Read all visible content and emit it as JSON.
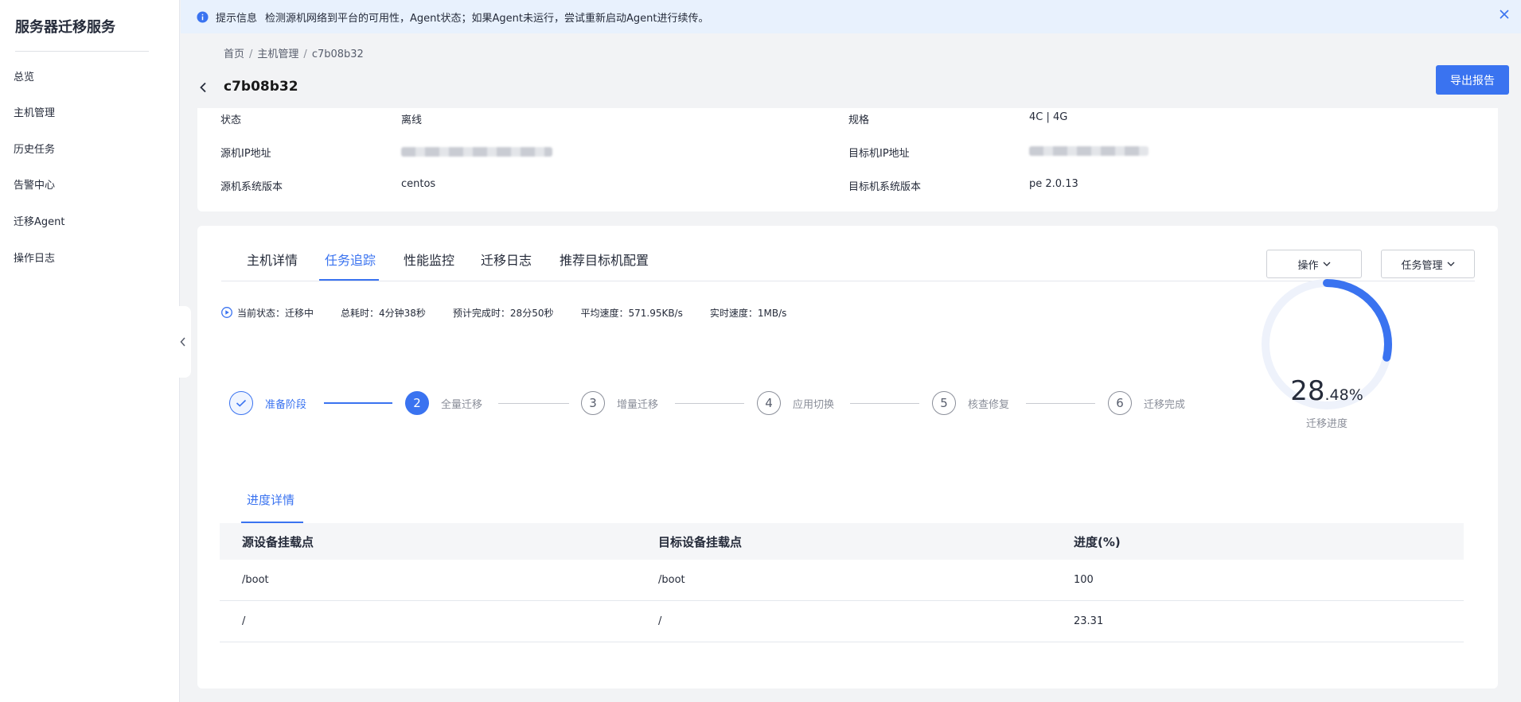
{
  "sidebar": {
    "title": "服务器迁移服务",
    "items": [
      {
        "label": "总览"
      },
      {
        "label": "主机管理"
      },
      {
        "label": "历史任务"
      },
      {
        "label": "告警中心"
      },
      {
        "label": "迁移Agent"
      },
      {
        "label": "操作日志"
      }
    ]
  },
  "notice": {
    "title": "提示信息",
    "text": "检测源机网络到平台的可用性，Agent状态；如果Agent未运行，尝试重新启动Agent进行续传。"
  },
  "breadcrumb": {
    "items": [
      "首页",
      "主机管理",
      "c7b08b32"
    ],
    "separator": "/"
  },
  "header": {
    "title": "c7b08b32",
    "export_label": "导出报告"
  },
  "info": {
    "status_label": "状态",
    "status_value": "离线",
    "spec_label": "规格",
    "spec_value": "4C | 4G",
    "source_ip_label": "源机IP地址",
    "target_ip_label": "目标机IP地址",
    "source_os_label": "源机系统版本",
    "source_os_value": "centos",
    "target_os_label": "目标机系统版本",
    "target_os_value": "pe 2.0.13"
  },
  "tabs": [
    {
      "label": "主机详情",
      "active": false
    },
    {
      "label": "任务追踪",
      "active": true
    },
    {
      "label": "性能监控",
      "active": false
    },
    {
      "label": "迁移日志",
      "active": false
    },
    {
      "label": "推荐目标机配置",
      "active": false
    }
  ],
  "actions": {
    "operate_label": "操作",
    "task_manage_label": "任务管理"
  },
  "status": {
    "current": "当前状态：迁移中",
    "elapsed": "总耗时：4分钟38秒",
    "eta": "预计完成时：28分50秒",
    "avg_speed": "平均速度：571.95KB/s",
    "live_speed": "实时速度：1MB/s"
  },
  "steps": [
    {
      "number": "✓",
      "label": "准备阶段",
      "state": "done"
    },
    {
      "number": "2",
      "label": "全量迁移",
      "state": "current"
    },
    {
      "number": "3",
      "label": "增量迁移",
      "state": "pending"
    },
    {
      "number": "4",
      "label": "应用切换",
      "state": "pending"
    },
    {
      "number": "5",
      "label": "核查修复",
      "state": "pending"
    },
    {
      "number": "6",
      "label": "迁移完成",
      "state": "pending"
    }
  ],
  "progress": {
    "value": 28.48,
    "int_part": "28",
    "dec_part": ".48%",
    "label": "迁移进度",
    "color": "#3a73f0",
    "track_color": "#eef2fb"
  },
  "subtab": {
    "label": "进度详情"
  },
  "table": {
    "headers": [
      "源设备挂载点",
      "目标设备挂载点",
      "进度(%)"
    ],
    "rows": [
      [
        "/boot",
        "/boot",
        "100"
      ],
      [
        "/",
        "/",
        "23.31"
      ]
    ]
  }
}
